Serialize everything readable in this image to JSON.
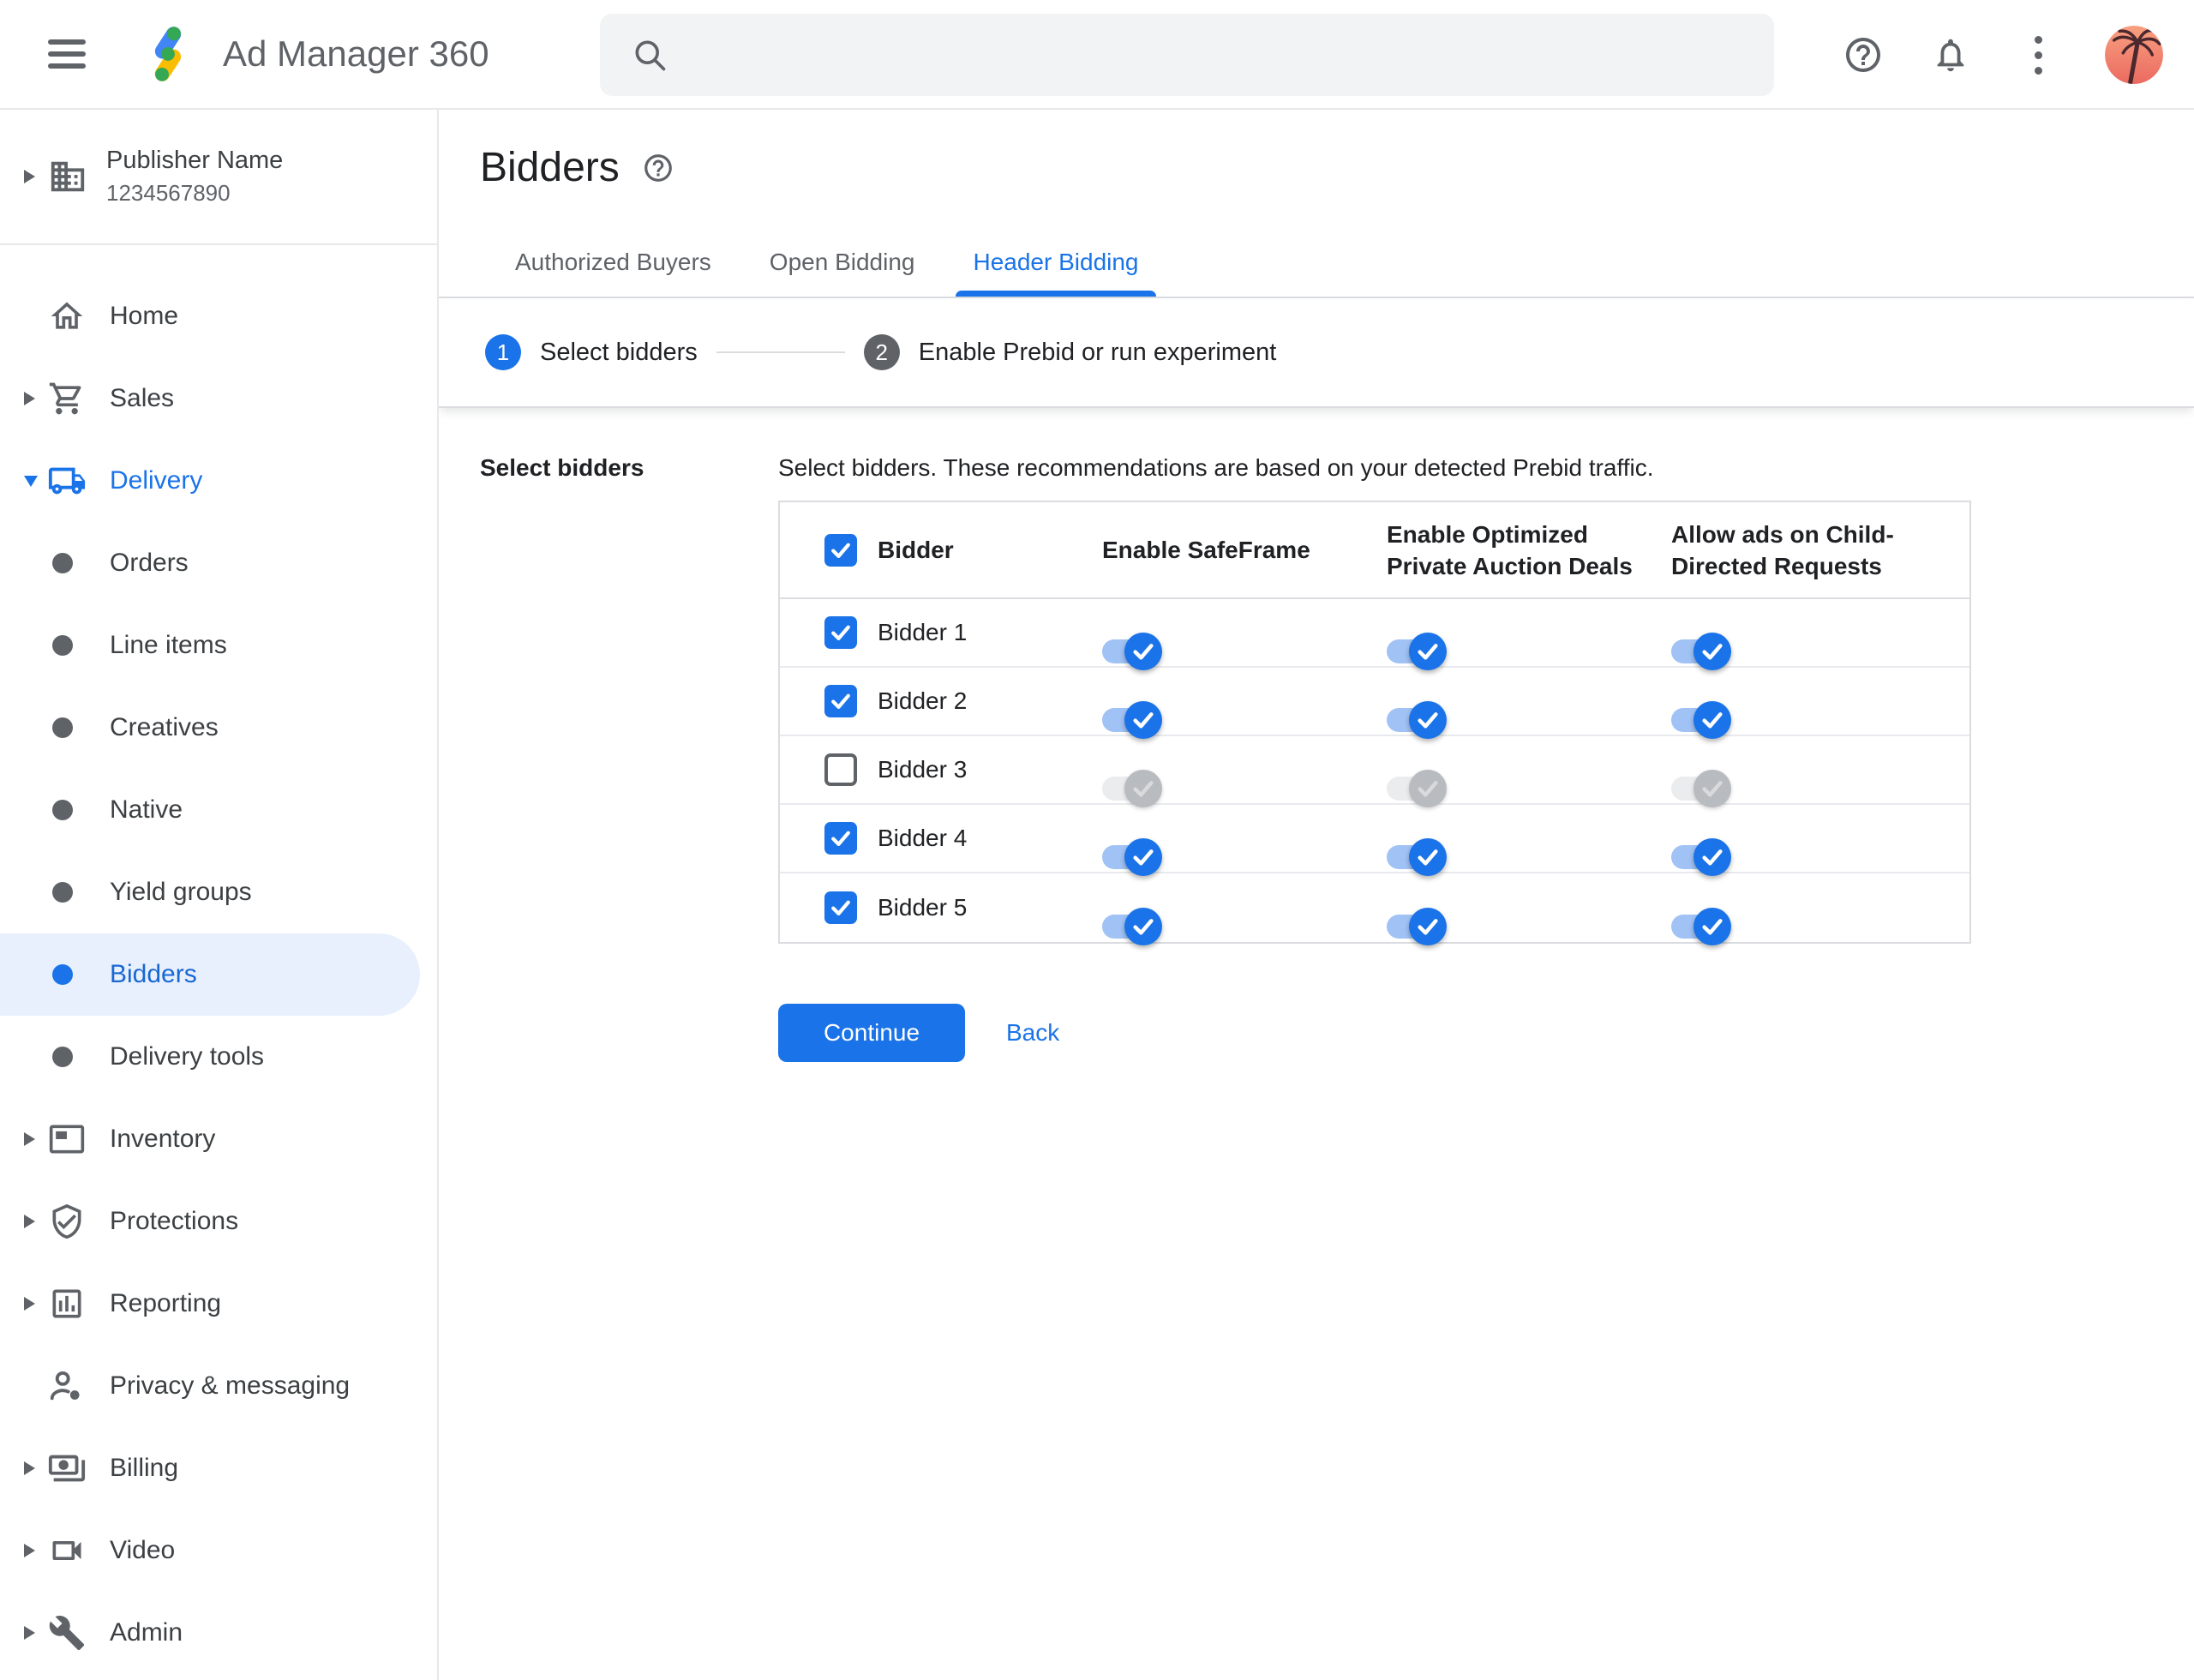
{
  "topbar": {
    "app_name": "Ad Manager 360",
    "search_placeholder": "",
    "icons": [
      "menu-icon",
      "ad-manager-logo",
      "search-icon",
      "help-icon",
      "notifications-icon",
      "more-options-icon",
      "avatar"
    ]
  },
  "sidebar": {
    "publisher": {
      "name": "Publisher Name",
      "id": "1234567890"
    },
    "items": [
      {
        "label": "Home",
        "icon": "home",
        "type": "top"
      },
      {
        "label": "Sales",
        "icon": "cart",
        "type": "top",
        "caret": "right"
      },
      {
        "label": "Delivery",
        "icon": "truck",
        "type": "top",
        "caret": "down",
        "expanded": true,
        "blue": true
      },
      {
        "label": "Orders",
        "type": "sub"
      },
      {
        "label": "Line items",
        "type": "sub"
      },
      {
        "label": "Creatives",
        "type": "sub"
      },
      {
        "label": "Native",
        "type": "sub"
      },
      {
        "label": "Yield groups",
        "type": "sub"
      },
      {
        "label": "Bidders",
        "type": "sub",
        "selected": true
      },
      {
        "label": "Delivery tools",
        "type": "sub"
      },
      {
        "label": "Inventory",
        "icon": "inventory",
        "type": "top",
        "caret": "right"
      },
      {
        "label": "Protections",
        "icon": "shield",
        "type": "top",
        "caret": "right"
      },
      {
        "label": "Reporting",
        "icon": "report",
        "type": "top",
        "caret": "right"
      },
      {
        "label": "Privacy & messaging",
        "icon": "privacy",
        "type": "top"
      },
      {
        "label": "Billing",
        "icon": "billing",
        "type": "top",
        "caret": "right"
      },
      {
        "label": "Video",
        "icon": "video",
        "type": "top",
        "caret": "right"
      },
      {
        "label": "Admin",
        "icon": "admin",
        "type": "top",
        "caret": "right"
      }
    ]
  },
  "page": {
    "title": "Bidders",
    "tabs": [
      {
        "label": "Authorized Buyers",
        "active": false
      },
      {
        "label": "Open Bidding",
        "active": false
      },
      {
        "label": "Header Bidding",
        "active": true
      }
    ],
    "stepper": [
      {
        "num": "1",
        "label": "Select bidders",
        "state": "active"
      },
      {
        "num": "2",
        "label": "Enable Prebid or run experiment",
        "state": "upcoming"
      }
    ],
    "section_label": "Select bidders",
    "description": "Select bidders. These recommendations are based on your detected Prebid traffic.",
    "table": {
      "headers": [
        "Bidder",
        "Enable SafeFrame",
        "Enable Optimized Private Auction Deals",
        "Allow ads on Child-Directed Requests"
      ],
      "header_checkbox_checked": true,
      "rows": [
        {
          "name": "Bidder 1",
          "checked": true,
          "toggles": [
            true,
            true,
            true
          ]
        },
        {
          "name": "Bidder 2",
          "checked": true,
          "toggles": [
            true,
            true,
            true
          ]
        },
        {
          "name": "Bidder 3",
          "checked": false,
          "toggles": [
            false,
            false,
            false
          ]
        },
        {
          "name": "Bidder 4",
          "checked": true,
          "toggles": [
            true,
            true,
            true
          ]
        },
        {
          "name": "Bidder 5",
          "checked": true,
          "toggles": [
            true,
            true,
            true
          ]
        }
      ]
    },
    "actions": {
      "continue": "Continue",
      "back": "Back"
    }
  },
  "colors": {
    "accent": "#1a73e8",
    "selected_text": "#1967d2",
    "selected_bg": "#e8f0fe",
    "text_dark": "#202124",
    "text_gray": "#5f6368",
    "border": "#dadce0",
    "search_bg": "#f1f3f4",
    "toggle_track_on": "#a0c2f5",
    "disabled_gray": "#b8bbbf"
  }
}
